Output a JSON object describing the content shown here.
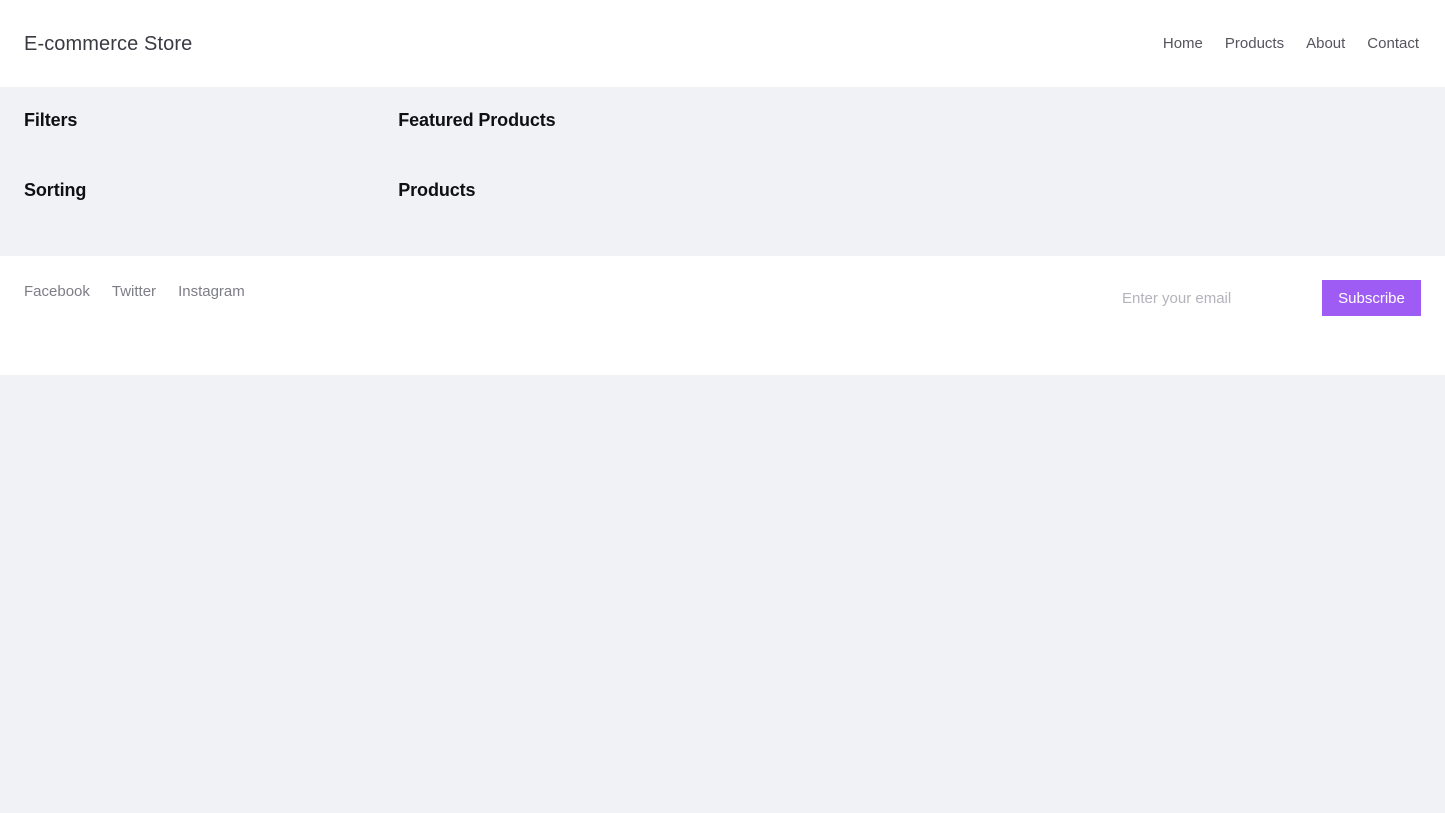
{
  "theme": {
    "page_background": "#f1f2f6",
    "surface": "#ffffff",
    "accent": "#9f5cf5",
    "heading_color": "#101014",
    "muted_text": "#7d7d87",
    "nav_text": "#55555d"
  },
  "header": {
    "brand": "E-commerce Store",
    "nav": [
      {
        "label": "Home"
      },
      {
        "label": "Products"
      },
      {
        "label": "About"
      },
      {
        "label": "Contact"
      }
    ]
  },
  "sidebar": {
    "blocks": [
      {
        "title": "Filters"
      },
      {
        "title": "Sorting"
      }
    ]
  },
  "main": {
    "blocks": [
      {
        "title": "Featured Products"
      },
      {
        "title": "Products"
      }
    ]
  },
  "footer": {
    "social": [
      {
        "label": "Facebook"
      },
      {
        "label": "Twitter"
      },
      {
        "label": "Instagram"
      }
    ],
    "newsletter": {
      "placeholder": "Enter your email",
      "value": "",
      "submit_label": "Subscribe"
    }
  }
}
